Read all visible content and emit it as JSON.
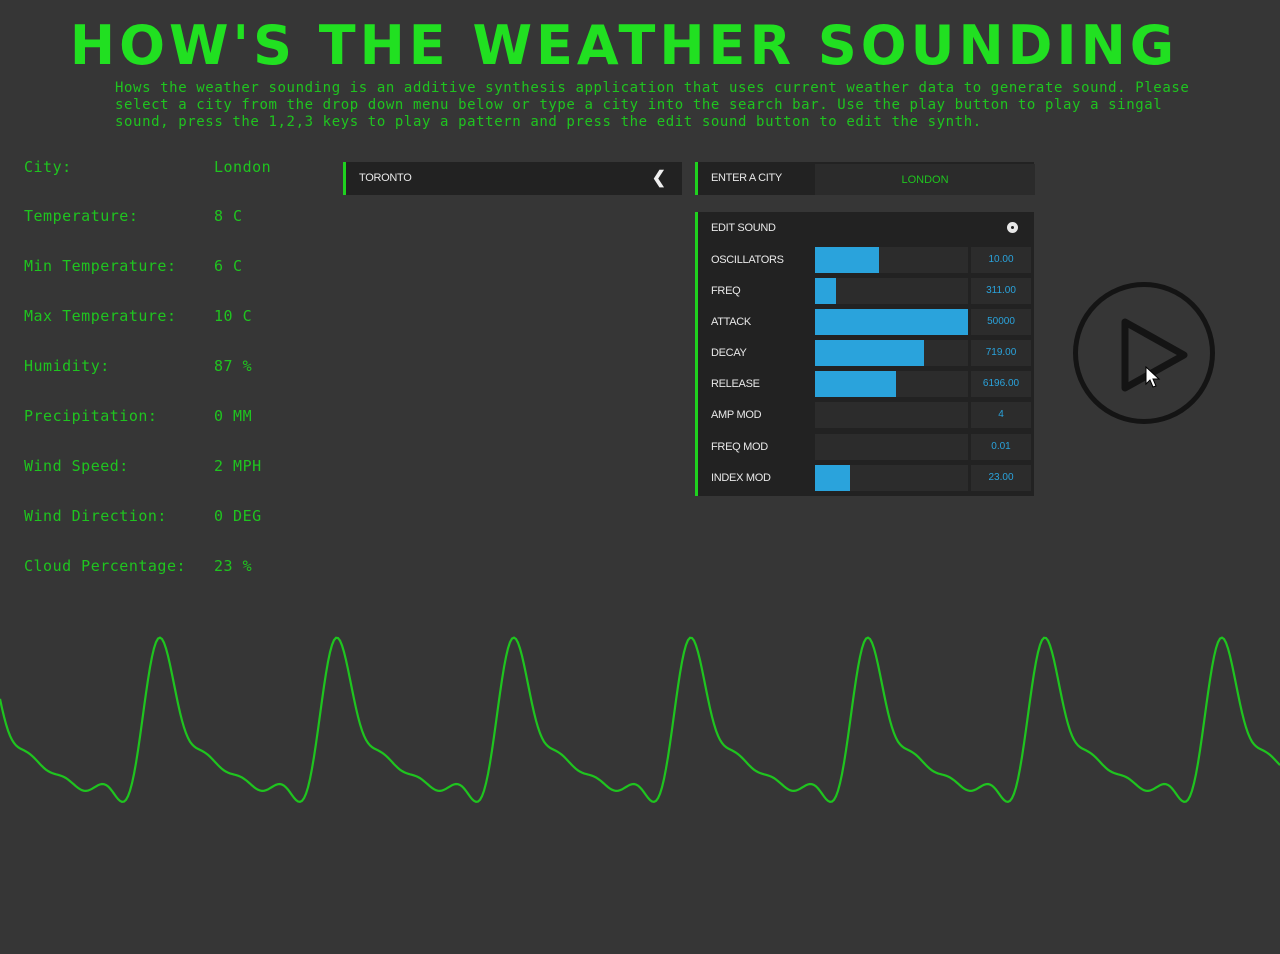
{
  "header": {
    "title": "HOW'S THE WEATHER SOUNDING",
    "description": "Hows the weather sounding is an additive synthesis application that uses current weather data to generate sound. Please select a city from the drop down menu below or type a city into the search bar. Use the play button to play a singal sound, press the 1,2,3 keys to play a pattern and press the edit sound button to edit the synth."
  },
  "weather": [
    {
      "label": "City:",
      "value": "London"
    },
    {
      "label": "Temperature:",
      "value": "8 C"
    },
    {
      "label": "Min Temperature:",
      "value": "6 C"
    },
    {
      "label": "Max Temperature:",
      "value": "10 C"
    },
    {
      "label": "Humidity:",
      "value": "87 %"
    },
    {
      "label": "Precipitation:",
      "value": "0 MM"
    },
    {
      "label": "Wind Speed:",
      "value": "2 MPH"
    },
    {
      "label": "Wind Direction:",
      "value": "0 DEG"
    },
    {
      "label": "Cloud Percentage:",
      "value": "23 %"
    }
  ],
  "city_dropdown": {
    "selected": "TORONTO",
    "chevron_icon": "chevron-left-icon"
  },
  "city_search": {
    "label": "ENTER A CITY",
    "value": "LONDON"
  },
  "edit_sound": {
    "title": "EDIT SOUND",
    "close_icon": "close-circle-icon",
    "params": [
      {
        "label": "OSCILLATORS",
        "value": "10.00",
        "level": 0.42
      },
      {
        "label": "FREQ",
        "value": "311.00",
        "level": 0.14
      },
      {
        "label": "ATTACK",
        "value": "50000",
        "level": 1.0
      },
      {
        "label": "DECAY",
        "value": "719.00",
        "level": 0.71
      },
      {
        "label": "RELEASE",
        "value": "6196.00",
        "level": 0.53
      },
      {
        "label": "AMP MOD",
        "value": "4",
        "level": 0.0
      },
      {
        "label": "FREQ MOD",
        "value": "0.01",
        "level": 0.0
      },
      {
        "label": "INDEX MOD",
        "value": "23.00",
        "level": 0.23
      }
    ]
  },
  "play_button": {
    "icon": "play-icon"
  },
  "colors": {
    "background": "#363636",
    "accent_green": "#1fc41f",
    "title_green": "#21e021",
    "slider_blue": "#2aa3dc",
    "panel": "#222222"
  },
  "waveform": {
    "color": "#1fc41f",
    "shape": "periodic additive waveform"
  }
}
